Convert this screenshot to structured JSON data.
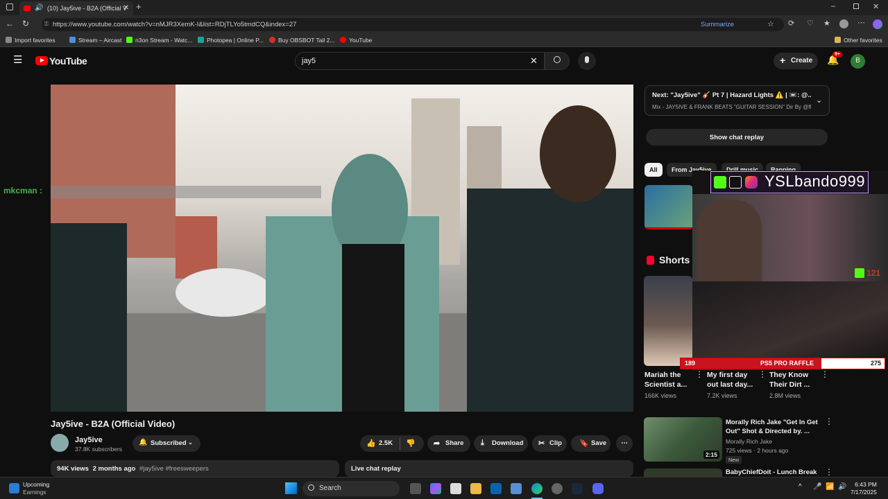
{
  "browser": {
    "tab_title": "(10) Jay5ive - B2A (Official V",
    "url": "https://www.youtube.com/watch?v=nMJR3XemK-I&list=RDjTLYo5tmdCQ&index=27",
    "summarize": "Summarize",
    "bookmarks": [
      {
        "label": "Import favorites",
        "color": "#888888"
      },
      {
        "label": "Stream – Aircast",
        "color": "#4a90d9"
      },
      {
        "label": "n3on Stream - Watc...",
        "color": "#53fc18"
      },
      {
        "label": "Photopea | Online P...",
        "color": "#18a497"
      },
      {
        "label": "Buy OBSBOT Tail 2...",
        "color": "#d32f2f"
      },
      {
        "label": "YouTube",
        "color": "#ff0000"
      }
    ],
    "other_favorites": "Other favorites"
  },
  "youtube": {
    "logo": "YouTube",
    "search_value": "jay5",
    "create": "Create",
    "notif_count": "9+",
    "avatar_letter": "B"
  },
  "video": {
    "title": "Jay5ive - B2A (Official Video)",
    "channel": "Jay5ive",
    "subscribers": "37.8K subscribers",
    "subscribed": "Subscribed",
    "likes": "2.5K",
    "share": "Share",
    "download": "Download",
    "clip": "Clip",
    "save": "Save",
    "views": "94K views",
    "date": "2 months ago",
    "tags": "#jay5ive #freesweepers",
    "live_chat_replay": "Live chat replay",
    "chat_overlay_user": "mkcman :"
  },
  "sidebar": {
    "next_title": "Next: \"Jay5ive\" 🎸 Pt 7 | Hazard Lights ⚠️ | 📼: @...",
    "next_sub": "Mix - JAY5IVE & FRANK BEATS \"GUITAR SESSION\" Dir By @fl...",
    "show_chat": "Show chat replay",
    "chips": [
      "All",
      "From Jay5ive",
      "Drill music",
      "Rapping"
    ],
    "shorts_heading": "Shorts",
    "shorts": [
      {
        "title": "Mariah the Scientist a...",
        "views": "166K views"
      },
      {
        "title": "My first day out last day...",
        "views": "7.2K views"
      },
      {
        "title": "They Know Their Dirt ...",
        "views": "2.8M views"
      }
    ],
    "rec": {
      "title": "Morally Rich Jake \"Get In Get Out\" Shot & Directed by. ...",
      "channel": "Morally Rich Jake",
      "meta": "725 views · 2 hours ago",
      "badge": "New",
      "duration": "2:15"
    },
    "rec2_title": "BabyChiefDoit - Lunch Break"
  },
  "stream_overlay": {
    "handle": "YSLbando999",
    "kick_count": "121",
    "raffle_left": "189",
    "raffle_label": "PS5 PRO RAFFLE",
    "raffle_right": "275",
    "raffle_progress": 0.69
  },
  "taskbar": {
    "weather_title": "Upcoming",
    "weather_sub": "Earnings",
    "search": "Search",
    "time": "6:43 PM",
    "date": "7/17/2025"
  }
}
